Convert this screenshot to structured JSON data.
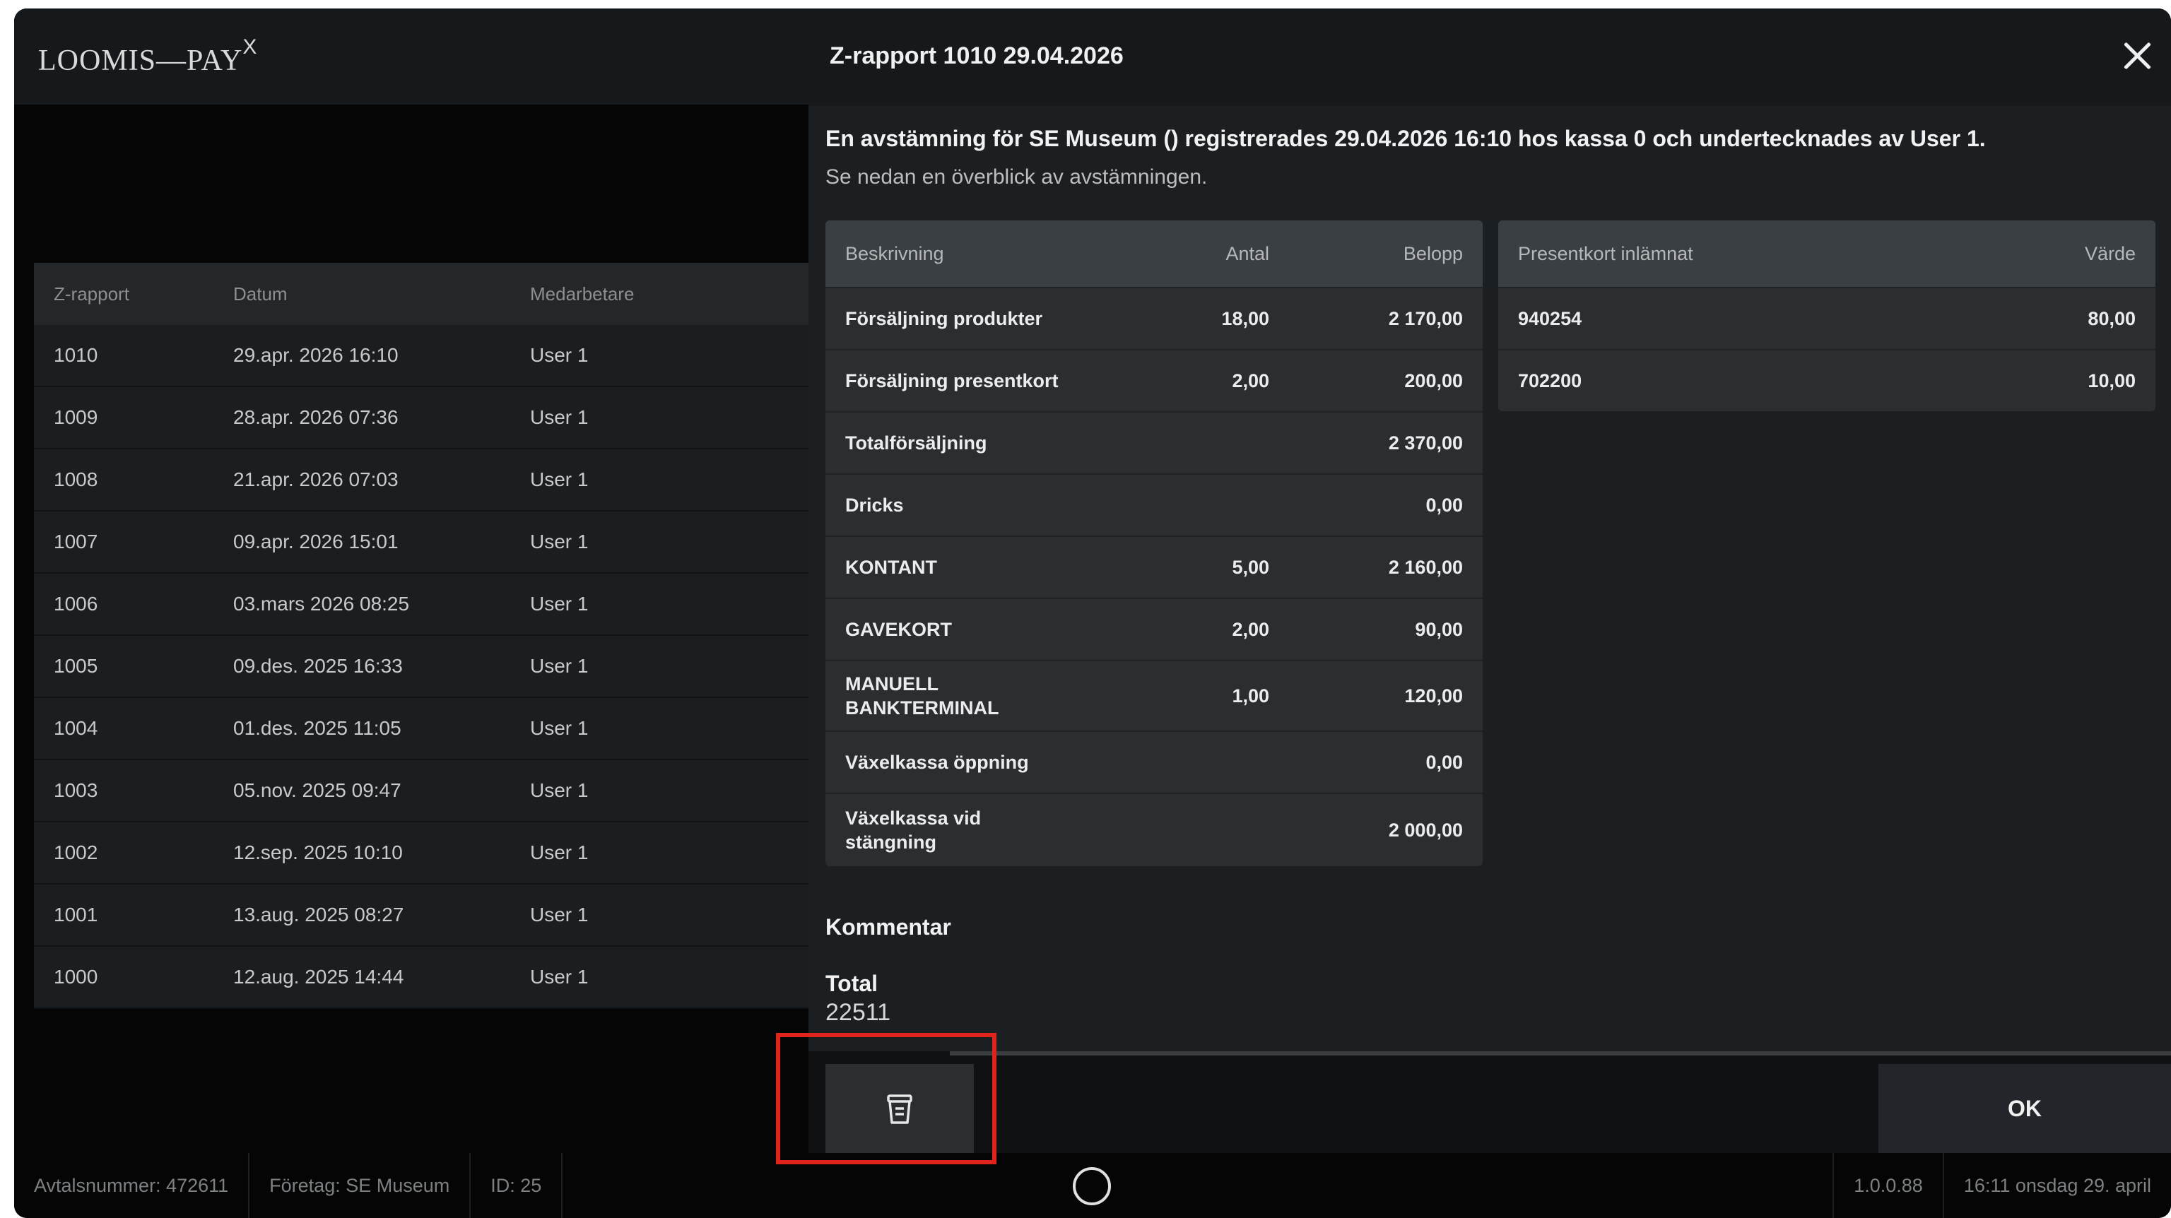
{
  "app": {
    "logo": "LOOMIS—PAY",
    "logo_sup": "X"
  },
  "z_list": {
    "headers": [
      "Z-rapport",
      "Datum",
      "Medarbetare"
    ],
    "rows": [
      [
        "1010",
        "29.apr. 2026 16:10",
        "User 1"
      ],
      [
        "1009",
        "28.apr. 2026 07:36",
        "User 1"
      ],
      [
        "1008",
        "21.apr. 2026 07:03",
        "User 1"
      ],
      [
        "1007",
        "09.apr. 2026 15:01",
        "User 1"
      ],
      [
        "1006",
        "03.mars 2026 08:25",
        "User 1"
      ],
      [
        "1005",
        "09.des. 2025 16:33",
        "User 1"
      ],
      [
        "1004",
        "01.des. 2025 11:05",
        "User 1"
      ],
      [
        "1003",
        "05.nov. 2025 09:47",
        "User 1"
      ],
      [
        "1002",
        "12.sep. 2025 10:10",
        "User 1"
      ],
      [
        "1001",
        "13.aug. 2025 08:27",
        "User 1"
      ],
      [
        "1000",
        "12.aug. 2025 14:44",
        "User 1"
      ]
    ]
  },
  "modal": {
    "title": "Z-rapport 1010 29.04.2026",
    "intro_line1": "En avstämning för SE Museum () registrerades 29.04.2026 16:10 hos kassa 0 och undertecknades av User 1.",
    "intro_line2": "Se nedan en överblick av avstämningen.",
    "summary": {
      "headers": [
        "Beskrivning",
        "Antal",
        "Belopp"
      ],
      "rows": [
        [
          "Försäljning produkter",
          "18,00",
          "2 170,00"
        ],
        [
          "Försäljning presentkort",
          "2,00",
          "200,00"
        ],
        [
          "Totalförsäljning",
          "",
          "2 370,00"
        ],
        [
          "Dricks",
          "",
          "0,00"
        ],
        [
          "KONTANT",
          "5,00",
          "2 160,00"
        ],
        [
          "GAVEKORT",
          "2,00",
          "90,00"
        ],
        [
          "MANUELL BANKTERMINAL",
          "1,00",
          "120,00"
        ],
        [
          "Växelkassa öppning",
          "",
          "0,00"
        ],
        [
          "Växelkassa vid stängning",
          "",
          "2 000,00"
        ]
      ]
    },
    "giftcards": {
      "headers": [
        "Presentkort inlämnat",
        "Värde"
      ],
      "rows": [
        [
          "940254",
          "80,00"
        ],
        [
          "702200",
          "10,00"
        ]
      ]
    },
    "comment_label": "Kommentar",
    "total_label": "Total",
    "total_value": "22511",
    "ok_label": "OK"
  },
  "status_bar": {
    "agreement": "Avtalsnummer: 472611",
    "company": "Företag: SE Museum",
    "id": "ID: 25",
    "version": "1.0.0.88",
    "datetime": "16:11 onsdag 29. april"
  },
  "icons": {
    "delete": "trash-icon",
    "close": "close-icon",
    "home": "home-circle-icon"
  },
  "colors": {
    "highlight": "#e0231b",
    "background": "#000000",
    "panel": "#1c1f21"
  }
}
